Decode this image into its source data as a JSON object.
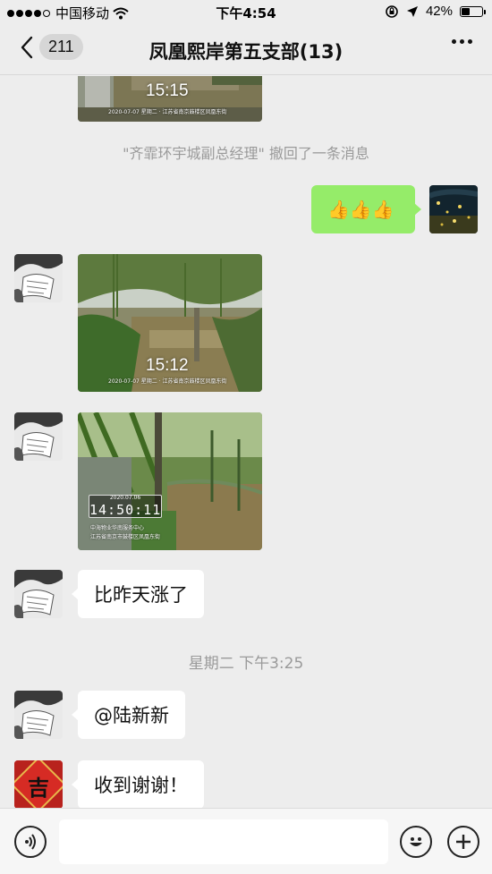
{
  "status_bar": {
    "carrier": "中国移动",
    "time": "下午4:54",
    "battery": "42%",
    "battery_level": 0.42
  },
  "nav": {
    "unread_count": "211",
    "title": "凤凰熙岸第五支部(13)"
  },
  "messages": {
    "photo_top": {
      "time": "15:15",
      "caption": "2020-07-07 星期二 · 江苏省南京鼓楼区凤凰东街"
    },
    "recall_notice": "\"齐霏环宇城副总经理\" 撤回了一条消息",
    "thumbs_bubble": "👍👍👍",
    "photo_1": {
      "time": "15:12",
      "caption": "2020-07-07 星期二 · 江苏省南京鼓楼区凤凰东街"
    },
    "photo_2": {
      "date": "2020.07.06",
      "time": "14:50:11",
      "caption1": "中海物业华南服务中心",
      "caption2": "江苏省南京市鼓楼区凤凰东街"
    },
    "text_1": "比昨天涨了",
    "timestamp": "星期二 下午3:25",
    "text_2": "@陆新新",
    "text_3": "收到谢谢！",
    "lucky_char": "吉"
  },
  "input_bar": {
    "placeholder": ""
  },
  "colors": {
    "background": "#ededed",
    "my_bubble": "#95ec69",
    "other_bubble": "#ffffff",
    "system_text": "#9a9a9a"
  }
}
